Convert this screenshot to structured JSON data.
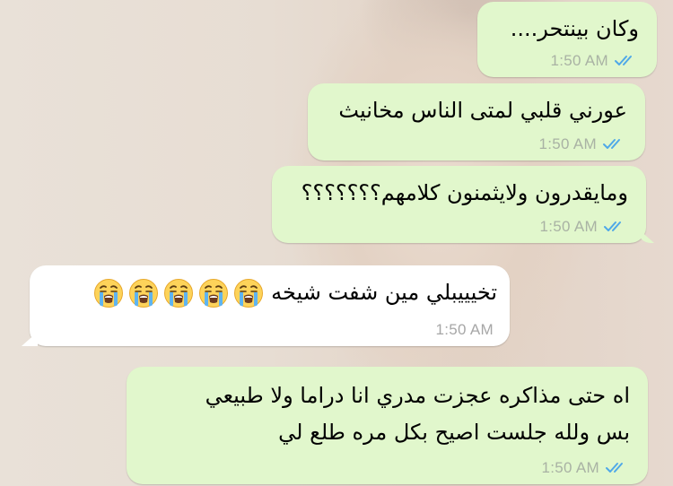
{
  "chat": {
    "colors": {
      "outgoing_bubble": "#e1f7cc",
      "incoming_bubble": "#ffffff",
      "read_ticks": "#4fa8e8",
      "timestamp": "#a9b2a4"
    },
    "messages": [
      {
        "direction": "outgoing",
        "text": "وكان بينتحر....",
        "time": "1:50 AM",
        "status_icon": "double-check-read-icon"
      },
      {
        "direction": "outgoing",
        "text": "عورني قلبي لمتى الناس مخانيث",
        "time": "1:50 AM",
        "status_icon": "double-check-read-icon"
      },
      {
        "direction": "outgoing",
        "text": "ومايقدرون ولايثمنون كلامهم؟؟؟؟؟؟؟",
        "time": "1:50 AM",
        "status_icon": "double-check-read-icon"
      },
      {
        "direction": "incoming",
        "text": "تخيييبلي مين شفت شيخه",
        "emoji": [
          "loudly-crying-face",
          "loudly-crying-face",
          "loudly-crying-face",
          "loudly-crying-face",
          "loudly-crying-face"
        ],
        "time": "1:50 AM"
      },
      {
        "direction": "outgoing",
        "lines": [
          "اه حتى مذاكره عجزت مدري انا دراما ولا طبيعي",
          "بس ولله جلست اصيح بكل مره طلع لي"
        ],
        "time": "1:50 AM",
        "status_icon": "double-check-read-icon"
      }
    ]
  }
}
